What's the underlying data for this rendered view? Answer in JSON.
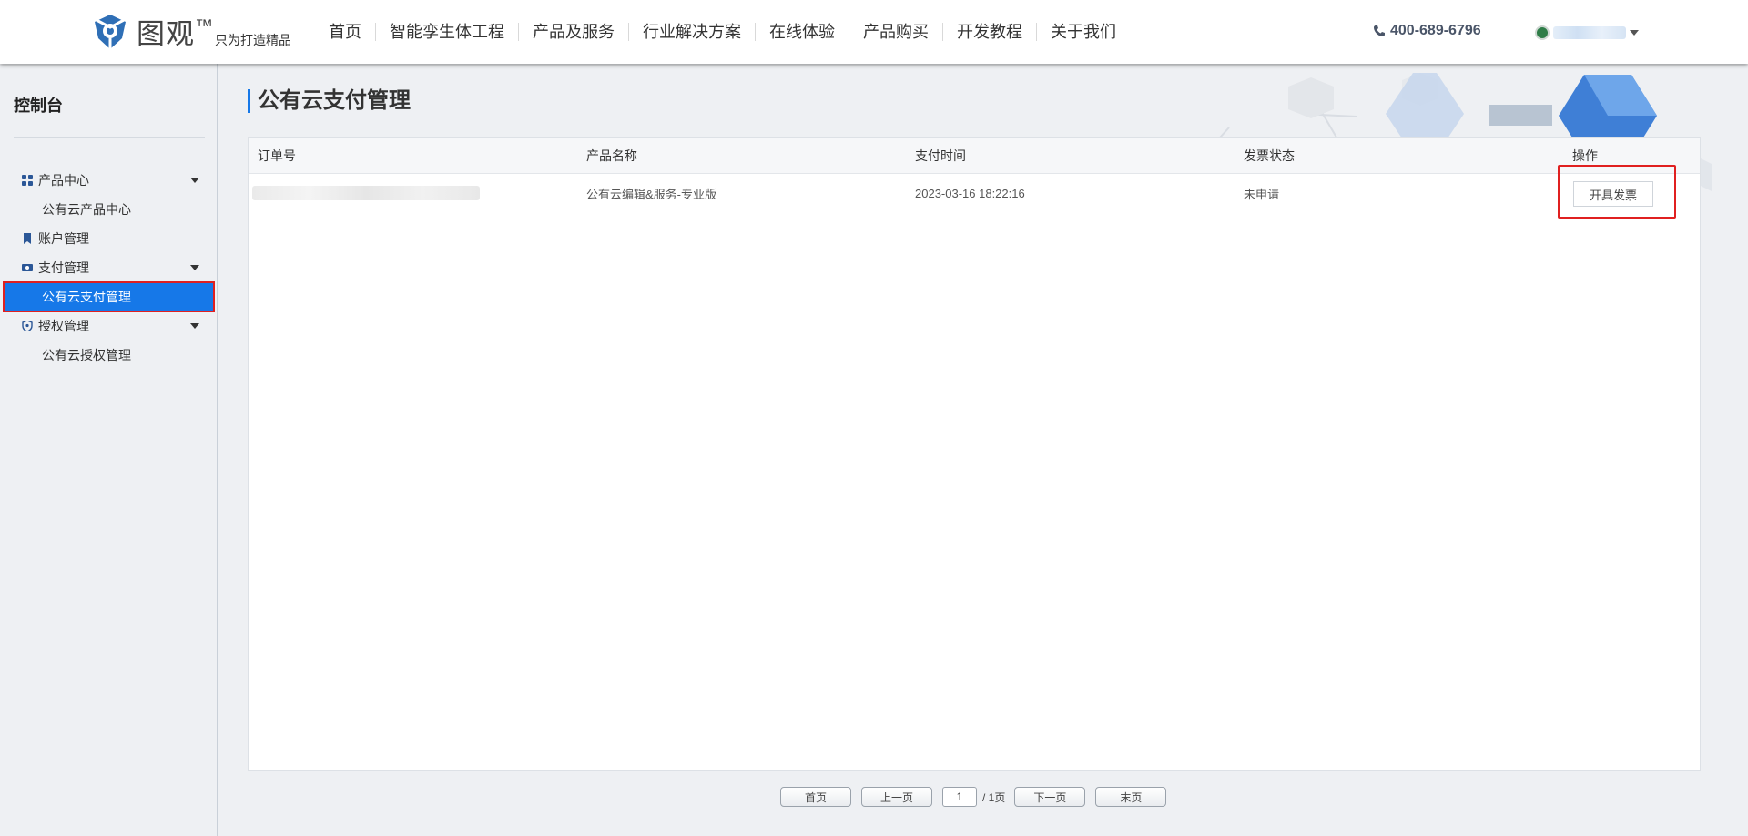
{
  "header": {
    "logo_name": "图观",
    "logo_tm": "™",
    "logo_slogan": "只为打造精品",
    "nav": [
      "首页",
      "智能孪生体工程",
      "产品及服务",
      "行业解决方案",
      "在线体验",
      "产品购买",
      "开发教程",
      "关于我们"
    ],
    "phone": "400-689-6796"
  },
  "sidebar": {
    "title": "控制台",
    "items": [
      {
        "label": "产品中心",
        "type": "group",
        "icon": "grid-icon"
      },
      {
        "label": "公有云产品中心",
        "type": "sub"
      },
      {
        "label": "账户管理",
        "type": "group",
        "icon": "bookmark-icon"
      },
      {
        "label": "支付管理",
        "type": "group",
        "icon": "ticket-icon"
      },
      {
        "label": "公有云支付管理",
        "type": "sub",
        "active": true
      },
      {
        "label": "授权管理",
        "type": "group",
        "icon": "shield-icon"
      },
      {
        "label": "公有云授权管理",
        "type": "sub"
      }
    ]
  },
  "main": {
    "title": "公有云支付管理",
    "table": {
      "headers": [
        "订单号",
        "产品名称",
        "支付时间",
        "发票状态",
        "操作"
      ],
      "rows": [
        {
          "product": "公有云编辑&服务-专业版",
          "pay_time": "2023-03-16 18:22:16",
          "invoice_status": "未申请",
          "action": "开具发票"
        }
      ]
    }
  },
  "pagination": {
    "first": "首页",
    "prev": "上一页",
    "current": "1",
    "total": "/ 1页",
    "next": "下一页",
    "last": "末页"
  },
  "colors": {
    "accent": "#1678e8",
    "highlight_border": "#e02020"
  }
}
